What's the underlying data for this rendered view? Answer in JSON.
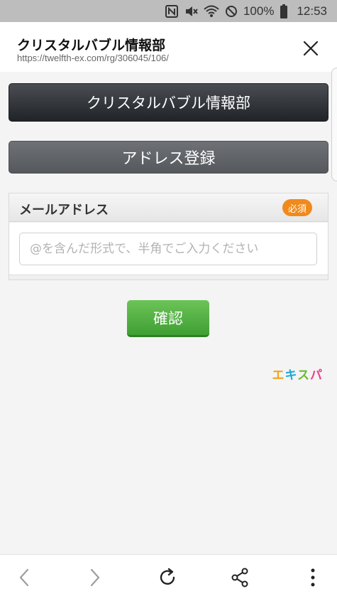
{
  "status_bar": {
    "battery_percent": "100%",
    "time": "12:53",
    "icons": [
      "nfc-icon",
      "vibrate-mute-icon",
      "wifi-icon",
      "no-signal-icon",
      "battery-icon"
    ]
  },
  "tab": {
    "title": "クリスタルバブル情報部",
    "url": "https://twelfth-ex.com/rg/306045/106/"
  },
  "page": {
    "banner_title": "クリスタルバブル情報部",
    "section_title": "アドレス登録",
    "form": {
      "label": "メールアドレス",
      "required_badge": "必須",
      "email_placeholder": "@を含んだ形式で、半角でご入力ください",
      "email_value": ""
    },
    "confirm_label": "確認",
    "logo_letters": [
      "エ",
      "キ",
      "ス",
      "パ"
    ]
  },
  "toolbar": {
    "buttons": [
      "back-icon",
      "forward-icon",
      "reload-icon",
      "share-icon",
      "more-icon"
    ]
  },
  "colors": {
    "confirm_green": "#4caf3e",
    "required_orange": "#f08a1c",
    "banner_dark": "#2b2f33",
    "section_gray": "#606367"
  }
}
